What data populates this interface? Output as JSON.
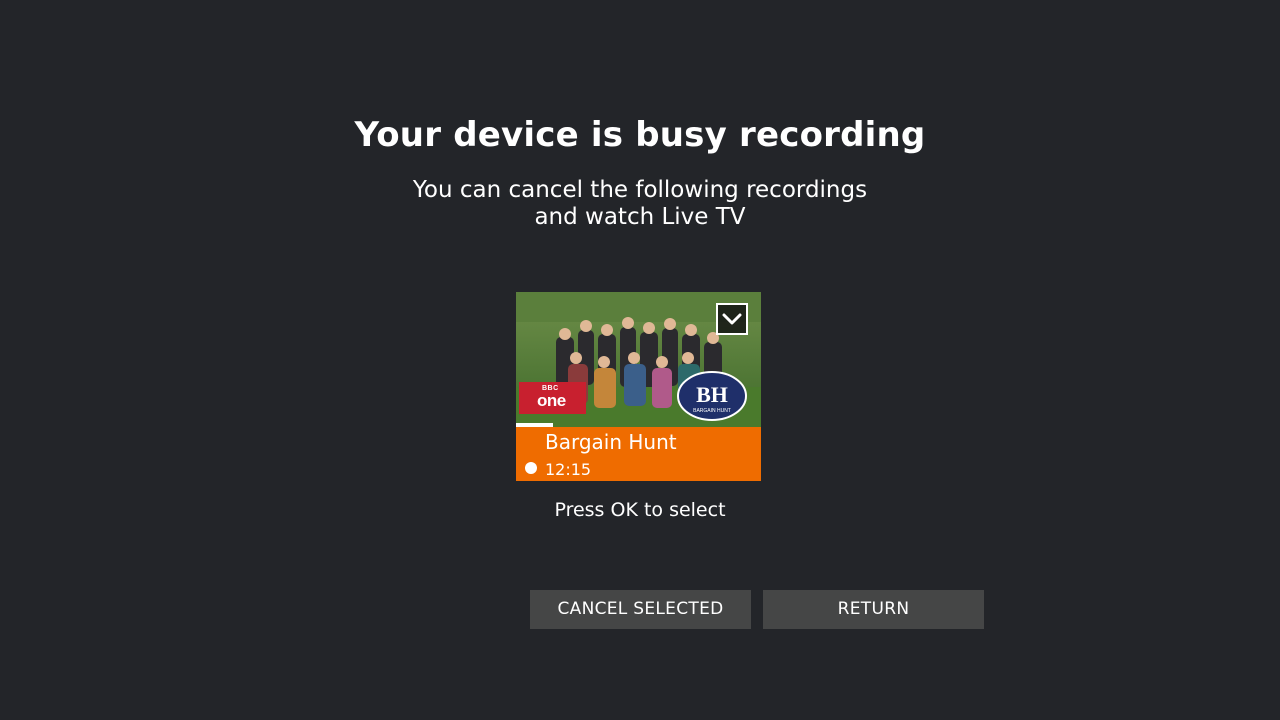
{
  "dialog": {
    "title": "Your device is busy recording",
    "subtitle_line1": "You can cancel the following recordings",
    "subtitle_line2": "and watch Live TV",
    "hint": "Press OK to select"
  },
  "recording": {
    "programme_title": "Bargain Hunt",
    "start_time": "12:15",
    "channel_logo_small": "BBC",
    "channel_logo_big": "one",
    "show_logo_text": "BH",
    "show_logo_subtext": "BARGAIN HUNT",
    "progress_fraction": 0.15,
    "selected": false
  },
  "buttons": {
    "cancel_selected": "CANCEL SELECTED",
    "return": "RETURN"
  },
  "icons": {
    "select": "chevron-down-icon",
    "record_indicator": "record-dot-icon"
  },
  "colors": {
    "background": "#232529",
    "card_accent": "#ef6c00",
    "button_bg": "#454646",
    "channel_red": "#c8202f"
  }
}
